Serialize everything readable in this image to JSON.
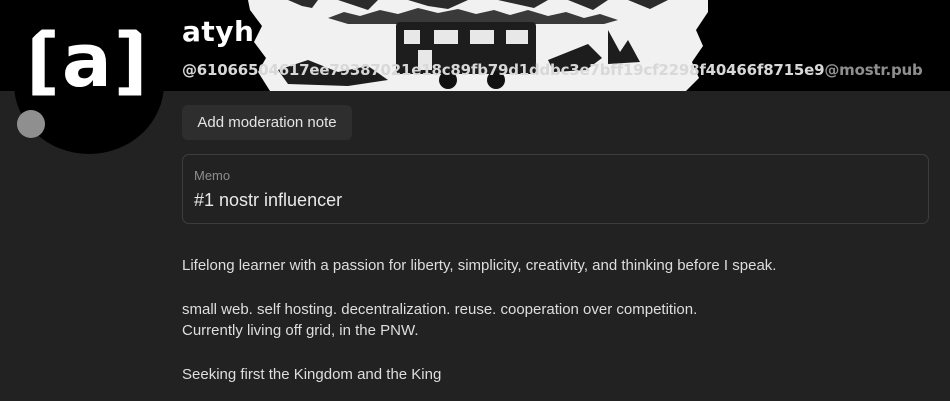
{
  "profile": {
    "display_name": "atyh",
    "avatar_text": "[a]",
    "nip05_prefix": "@61066504617ee79387021e18c89fb79d1ddbc3e7bff19cf2298f40466f8715e9",
    "nip05_domain": "@mostr.pub"
  },
  "actions": {
    "add_moderation_note": "Add moderation note"
  },
  "memo": {
    "label": "Memo",
    "value": "#1 nostr influencer"
  },
  "bio": {
    "line1": "Lifelong learner with a passion for liberty, simplicity, creativity, and thinking before I speak.",
    "line2": "small web. self hosting. decentralization. reuse. cooperation over competition.",
    "line3": "Currently living off grid, in the PNW.",
    "line4": "Seeking first the Kingdom and the King"
  },
  "colors": {
    "page_bg": "#222222",
    "header_bg": "#000000",
    "status_dot": "#8f8f8f"
  }
}
